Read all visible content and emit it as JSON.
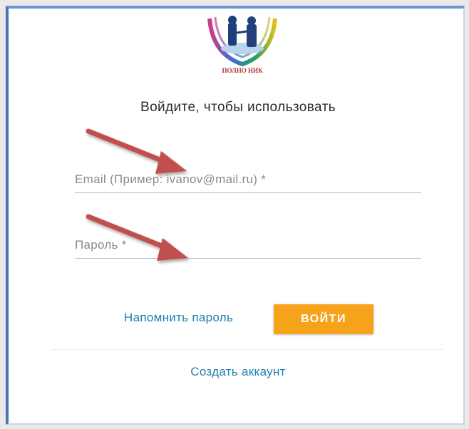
{
  "logo": {
    "caption": "ПОЛНО НИК"
  },
  "form": {
    "heading": "Войдите, чтобы использовать",
    "email_placeholder": "Email (Пример: ivanov@mail.ru) *",
    "password_placeholder": "Пароль *",
    "remind_label": "Напомнить пароль",
    "login_label": "ВОЙТИ",
    "create_account_label": "Создать аккаунт"
  },
  "colors": {
    "accent_button": "#f6a21b",
    "link": "#1d7fb0",
    "annotation_arrow": "#c0504d"
  },
  "annotations": {
    "arrows": [
      "arrow-to-email",
      "arrow-to-password"
    ]
  }
}
